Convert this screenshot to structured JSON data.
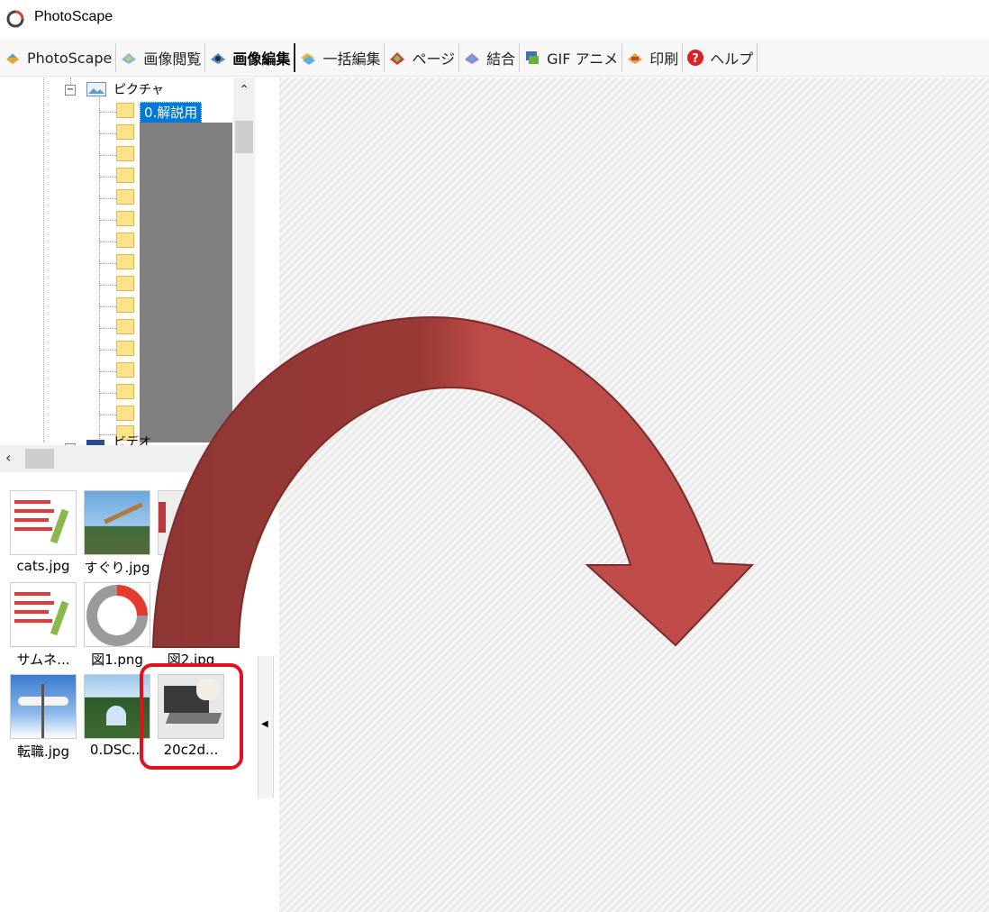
{
  "window": {
    "title": "PhotoScape"
  },
  "tabs": [
    {
      "label": "PhotoScape",
      "icon": "photoscape-tab-icon",
      "active": false
    },
    {
      "label": "画像閲覧",
      "icon": "viewer-tab-icon",
      "active": false
    },
    {
      "label": "画像編集",
      "icon": "editor-tab-icon",
      "active": true
    },
    {
      "label": "一括編集",
      "icon": "batch-tab-icon",
      "active": false
    },
    {
      "label": "ページ",
      "icon": "page-tab-icon",
      "active": false
    },
    {
      "label": "結合",
      "icon": "combine-tab-icon",
      "active": false
    },
    {
      "label": "GIF アニメ",
      "icon": "gif-tab-icon",
      "active": false
    },
    {
      "label": "印刷",
      "icon": "print-tab-icon",
      "active": false
    },
    {
      "label": "ヘルプ",
      "icon": "help-icon",
      "active": false
    }
  ],
  "tree": {
    "root_label": "ピクチャ",
    "selected_label": "0.解説用",
    "next_label": "ビデオ"
  },
  "thumbnails": [
    {
      "caption": "cats.jpg"
    },
    {
      "caption": "すぐり.jpg"
    },
    {
      "caption": ""
    },
    {
      "caption": "サムネ..."
    },
    {
      "caption": "図1.png"
    },
    {
      "caption": "図2.jpg"
    },
    {
      "caption": "転職.jpg"
    },
    {
      "caption": "0.DSC..."
    },
    {
      "caption": "20c2d..."
    }
  ],
  "colors": {
    "arrow_fill": "#bd4b47",
    "arrow_dark": "#963a37",
    "highlight": "#e3101d",
    "selection": "#0078d7"
  }
}
